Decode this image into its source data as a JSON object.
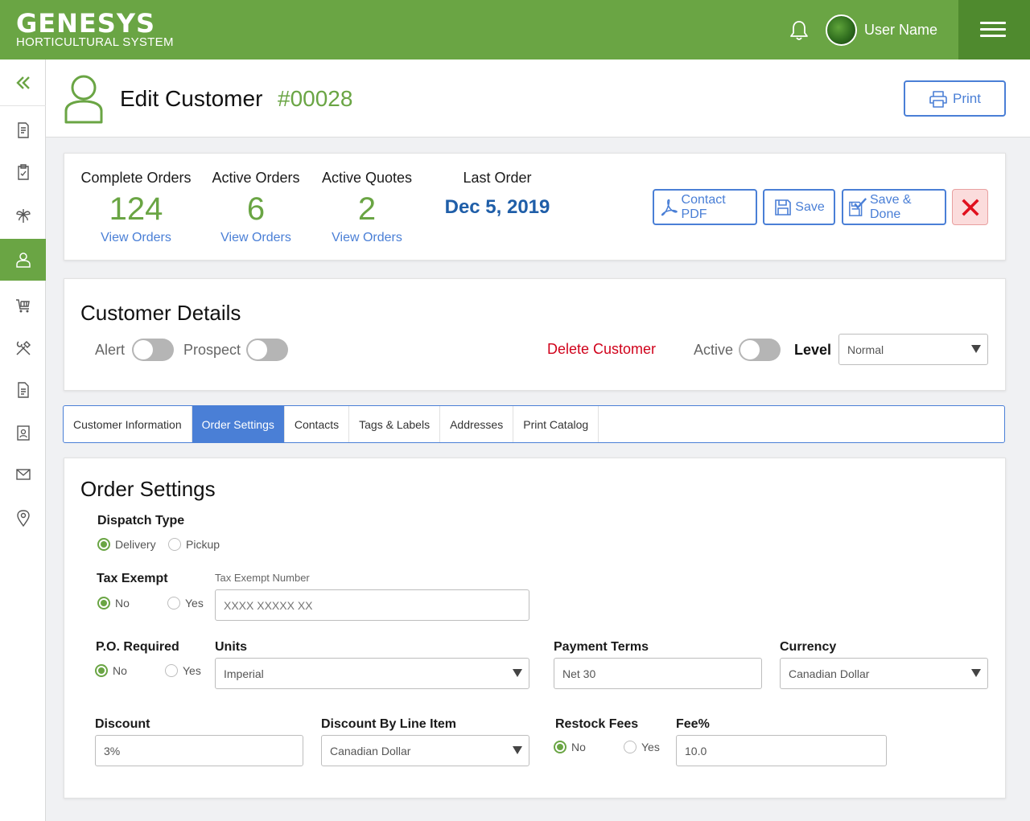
{
  "brand": {
    "name": "GENESYS",
    "subtitle": "HORTICULTURAL SYSTEM",
    "accent": "#6aa544",
    "link": "#4a7fd6"
  },
  "topbar": {
    "user_name": "User Name",
    "icons": [
      "bell-icon",
      "avatar",
      "hamburger-menu-icon"
    ]
  },
  "sidebar": {
    "items": [
      "collapse",
      "orders",
      "clipboard",
      "plants",
      "customers",
      "cart",
      "tools",
      "documents",
      "contacts",
      "mail",
      "locations"
    ],
    "active": "customers"
  },
  "header": {
    "title": "Edit Customer",
    "number": "#00028",
    "print_label": "Print"
  },
  "stats": [
    {
      "label": "Complete Orders",
      "value": "124",
      "link": "View Orders"
    },
    {
      "label": "Active Orders",
      "value": "6",
      "link": "View Orders"
    },
    {
      "label": "Active Quotes",
      "value": "2",
      "link": "View Orders"
    }
  ],
  "last_order": {
    "label": "Last Order",
    "value": "Dec 5, 2019"
  },
  "actions": {
    "contact_pdf": "Contact PDF",
    "save": "Save",
    "save_done": "Save & Done"
  },
  "customer_details": {
    "title": "Customer Details",
    "alert_label": "Alert",
    "alert_on": false,
    "prospect_label": "Prospect",
    "prospect_on": false,
    "delete_label": "Delete Customer",
    "active_label": "Active",
    "active_on": false,
    "level_label": "Level",
    "level_value": "Normal"
  },
  "tabs": [
    {
      "label": "Customer Information",
      "active": false
    },
    {
      "label": "Order Settings",
      "active": true
    },
    {
      "label": "Contacts",
      "active": false
    },
    {
      "label": "Tags & Labels",
      "active": false
    },
    {
      "label": "Addresses",
      "active": false
    },
    {
      "label": "Print Catalog",
      "active": false
    }
  ],
  "order_settings": {
    "title": "Order Settings",
    "dispatch": {
      "label": "Dispatch Type",
      "options": [
        "Delivery",
        "Pickup"
      ],
      "selected": "Delivery"
    },
    "tax_exempt": {
      "label": "Tax Exempt",
      "options": [
        "No",
        "Yes"
      ],
      "selected": "No",
      "number_label": "Tax Exempt Number",
      "number_placeholder": "XXXX XXXXX XX"
    },
    "po_required": {
      "label": "P.O. Required",
      "options": [
        "No",
        "Yes"
      ],
      "selected": "No"
    },
    "units": {
      "label": "Units",
      "value": "Imperial"
    },
    "payment_terms": {
      "label": "Payment Terms",
      "value": "Net 30"
    },
    "currency": {
      "label": "Currency",
      "value": "Canadian Dollar"
    },
    "discount": {
      "label": "Discount",
      "value": "3%"
    },
    "discount_line": {
      "label": "Discount By Line Item",
      "value": "Canadian Dollar"
    },
    "restock": {
      "label": "Restock Fees",
      "options": [
        "No",
        "Yes"
      ],
      "selected": "No"
    },
    "fee": {
      "label": "Fee%",
      "value": "10.0"
    }
  }
}
